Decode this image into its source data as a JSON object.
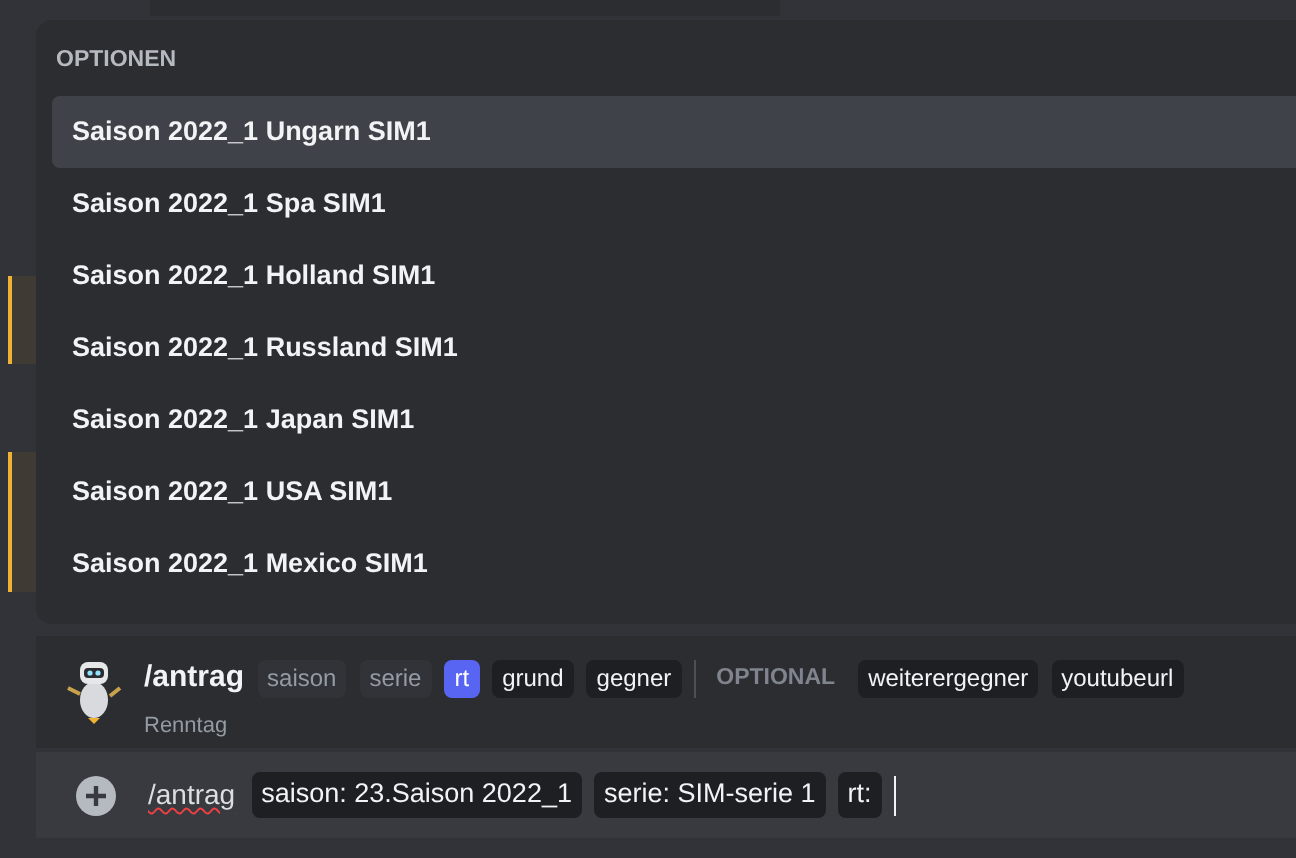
{
  "autocomplete": {
    "title": "OPTIONEN",
    "options": [
      {
        "label": "Saison 2022_1 Ungarn SIM1",
        "selected": true
      },
      {
        "label": "Saison 2022_1 Spa SIM1",
        "selected": false
      },
      {
        "label": "Saison 2022_1 Holland SIM1",
        "selected": false
      },
      {
        "label": "Saison 2022_1 Russland SIM1",
        "selected": false
      },
      {
        "label": "Saison 2022_1 Japan SIM1",
        "selected": false
      },
      {
        "label": "Saison 2022_1 USA SIM1",
        "selected": false
      },
      {
        "label": "Saison 2022_1 Mexico SIM1",
        "selected": false
      }
    ]
  },
  "command": {
    "name": "/antrag",
    "bot": "Renntag",
    "params": [
      {
        "label": "saison",
        "kind": "filled"
      },
      {
        "label": "serie",
        "kind": "filled"
      },
      {
        "label": "rt",
        "kind": "active"
      },
      {
        "label": "grund",
        "kind": "pending"
      },
      {
        "label": "gegner",
        "kind": "pending"
      },
      {
        "label": "OPTIONAL",
        "kind": "divider"
      },
      {
        "label": "weiterergegner",
        "kind": "pending"
      },
      {
        "label": "youtubeurl",
        "kind": "pending"
      }
    ]
  },
  "input": {
    "command": "/antrag",
    "chips": [
      "saison: 23.Saison 2022_1",
      "serie: SIM-serie 1",
      "rt:"
    ]
  }
}
